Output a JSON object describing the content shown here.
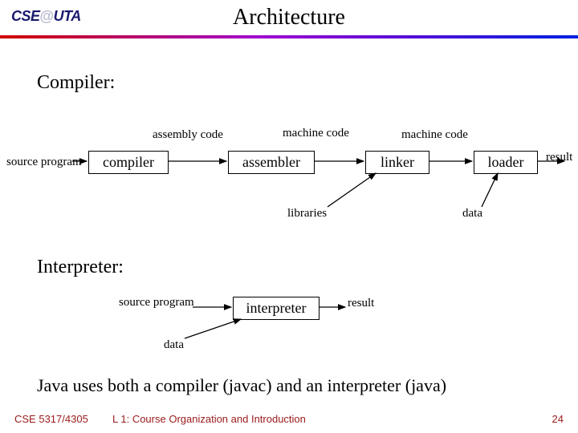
{
  "header": {
    "logo": "CSE@UTA",
    "title": "Architecture"
  },
  "sections": {
    "compiler": "Compiler:",
    "interpreter": "Interpreter:"
  },
  "compiler_pipeline": {
    "source_program": "source program",
    "compiler": "compiler",
    "assembly_code": "assembly code",
    "assembler": "assembler",
    "machine_code_1": "machine code",
    "linker": "linker",
    "machine_code_2": "machine code",
    "loader": "loader",
    "result": "result",
    "libraries": "libraries",
    "data": "data"
  },
  "interpreter_pipeline": {
    "source_program": "source program",
    "interpreter": "interpreter",
    "result": "result",
    "data": "data"
  },
  "java_note": "Java uses both a compiler (javac) and an interpreter (java)",
  "footer": {
    "course": "CSE 5317/4305",
    "lecture": "L 1: Course Organization and Introduction",
    "page": "24"
  }
}
